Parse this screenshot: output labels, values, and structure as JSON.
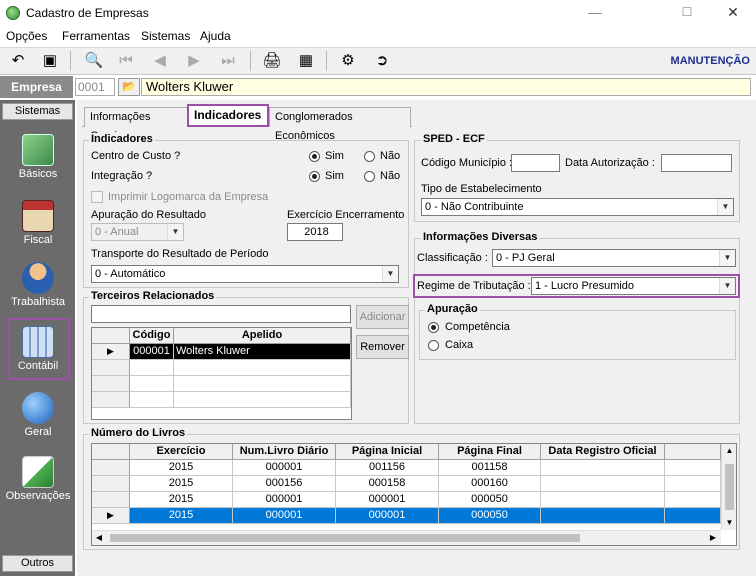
{
  "window": {
    "title": "Cadastro de Empresas",
    "minimize": "—",
    "maximize": "☐",
    "close": "✕"
  },
  "menu": [
    {
      "label": "Opções"
    },
    {
      "label": "Ferramentas"
    },
    {
      "label": "Sistemas"
    },
    {
      "label": "Ajuda"
    }
  ],
  "toolbar": {
    "mode": "MANUTENÇÃO"
  },
  "empresa": {
    "label": "Empresa",
    "code": "0001",
    "name": "Wolters Kluwer"
  },
  "sidebar": {
    "top_label": "Sistemas",
    "bottom_label": "Outros",
    "items": [
      {
        "label": "Básicos",
        "icon": "book-icon"
      },
      {
        "label": "Fiscal",
        "icon": "ledger-icon"
      },
      {
        "label": "Trabalhista",
        "icon": "worker-icon"
      },
      {
        "label": "Contábil",
        "icon": "calculator-icon"
      },
      {
        "label": "Geral",
        "icon": "globe-info-icon"
      },
      {
        "label": "Observações",
        "icon": "notepad-pen-icon"
      }
    ]
  },
  "tabs": [
    {
      "label": "Informações Gerais"
    },
    {
      "label": "Indicadores"
    },
    {
      "label": "Conglomerados Econômicos"
    }
  ],
  "indicadores": {
    "title": "Indicadores",
    "centro_custo": {
      "label": "Centro de Custo ?",
      "sim": "Sim",
      "nao": "Não",
      "value": "Sim"
    },
    "integracao": {
      "label": "Integração ?",
      "sim": "Sim",
      "nao": "Não",
      "value": "Sim"
    },
    "imprimir_logomarca": {
      "label": "Imprimir Logomarca da Empresa",
      "checked": false
    },
    "apuracao_resultado": {
      "label": "Apuração do Resultado",
      "value": "0 - Anual"
    },
    "exercicio_encerramento": {
      "label": "Exercício Encerramento",
      "value": "2018"
    },
    "transporte": {
      "label": "Transporte do Resultado de Período",
      "value": "0 - Automático"
    }
  },
  "terceiros": {
    "title": "Terceiros Relacionados",
    "search_value": "",
    "add_label": "Adicionar",
    "remove_label": "Remover",
    "columns": [
      "Código",
      "Apelido"
    ],
    "rows": [
      [
        "000001",
        "Wolters Kluwer"
      ]
    ]
  },
  "sped": {
    "title": "SPED - ECF",
    "codigo_municipio": {
      "label": "Código Município :",
      "value": ""
    },
    "data_autorizacao": {
      "label": "Data Autorização :",
      "value": ""
    },
    "tipo_estabelecimento": {
      "label": "Tipo de Estabelecimento",
      "value": "0 - Não Contribuinte"
    }
  },
  "diversas": {
    "title": "Informações Diversas",
    "classificacao": {
      "label": "Classificação :",
      "value": "0 - PJ Geral"
    },
    "regime": {
      "label": "Regime de Tributação :",
      "value": "1 - Lucro Presumido"
    },
    "apuracao": {
      "title": "Apuração",
      "competencia": "Competência",
      "caixa": "Caixa",
      "value": "Competência"
    }
  },
  "livros": {
    "title": "Número do Livros",
    "columns": [
      "Exercício",
      "Num.Livro Diário",
      "Página Inicial",
      "Página Final",
      "Data Registro Oficial"
    ],
    "rows": [
      [
        "2015",
        "000001",
        "001156",
        "001158",
        ""
      ],
      [
        "2015",
        "000156",
        "000158",
        "000160",
        ""
      ],
      [
        "2015",
        "000001",
        "000001",
        "000050",
        ""
      ],
      [
        "2015",
        "000001",
        "000001",
        "000050",
        ""
      ]
    ],
    "selected_row": 3
  }
}
